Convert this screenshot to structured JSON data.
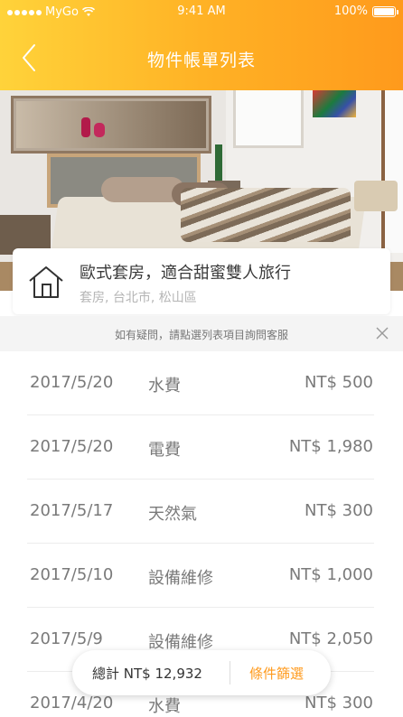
{
  "status_bar": {
    "carrier": "MyGo",
    "time": "9:41 AM",
    "battery": "100%"
  },
  "header": {
    "title": "物件帳單列表",
    "back_icon": "chevron-left-icon"
  },
  "hero": {
    "image": "bedroom-photo"
  },
  "property": {
    "title": "歐式套房，適合甜蜜雙人旅行",
    "subtitle": "套房, 台北市, 松山區",
    "icon": "house-icon"
  },
  "notice": {
    "text": "如有疑問，請點選列表項目詢問客服",
    "close_icon": "close-icon"
  },
  "bills": [
    {
      "date": "2017/5/20",
      "type": "水費",
      "amount": "NT$ 500"
    },
    {
      "date": "2017/5/20",
      "type": "電費",
      "amount": "NT$ 1,980"
    },
    {
      "date": "2017/5/17",
      "type": "天然氣",
      "amount": "NT$ 300"
    },
    {
      "date": "2017/5/10",
      "type": "設備維修",
      "amount": "NT$ 1,000"
    },
    {
      "date": "2017/5/9",
      "type": "設備維修",
      "amount": "NT$ 2,050"
    },
    {
      "date": "2017/4/20",
      "type": "水費",
      "amount": "NT$ 300"
    }
  ],
  "footer": {
    "total": "總計 NT$ 12,932",
    "filter_label": "條件篩選"
  },
  "colors": {
    "accent": "#ff9a1c",
    "gradient_start": "#ffd33a",
    "gradient_end": "#ff9a1c"
  }
}
